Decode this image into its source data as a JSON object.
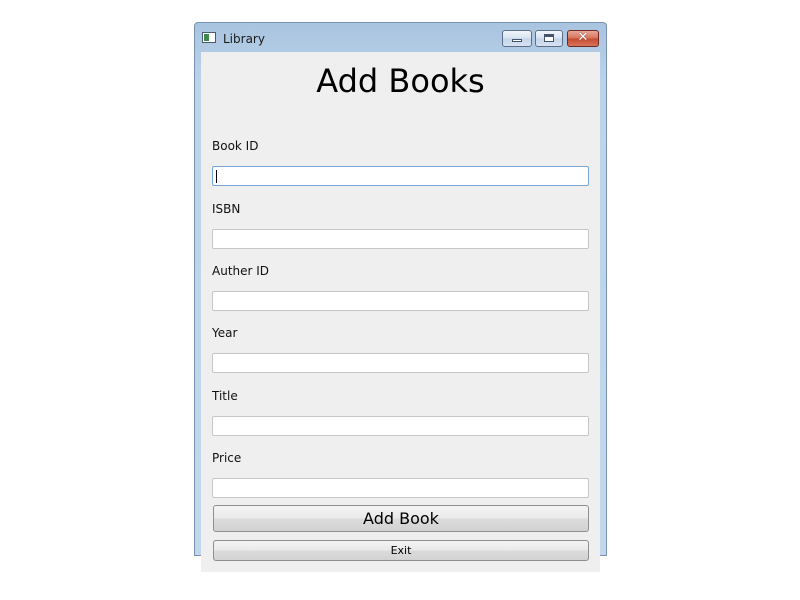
{
  "window": {
    "title": "Library",
    "icon": "app-window-icon",
    "controls": {
      "minimize_icon": "minimize-icon",
      "maximize_icon": "maximize-icon",
      "close_icon": "close-icon",
      "close_glyph": "✕"
    }
  },
  "form": {
    "heading": "Add Books",
    "fields": [
      {
        "label": "Book ID",
        "value": "",
        "placeholder": ""
      },
      {
        "label": "ISBN",
        "value": "",
        "placeholder": ""
      },
      {
        "label": "Auther ID",
        "value": "",
        "placeholder": ""
      },
      {
        "label": "Year",
        "value": "",
        "placeholder": ""
      },
      {
        "label": "Title",
        "value": "",
        "placeholder": ""
      },
      {
        "label": "Price",
        "value": "",
        "placeholder": ""
      }
    ],
    "focused_field": "Book ID",
    "add_button_label": "Add Book",
    "exit_button_label": "Exit"
  },
  "colors": {
    "client_background": "#efefef",
    "focus_border": "#7aa7d6",
    "close_button": "#c44a2f"
  }
}
